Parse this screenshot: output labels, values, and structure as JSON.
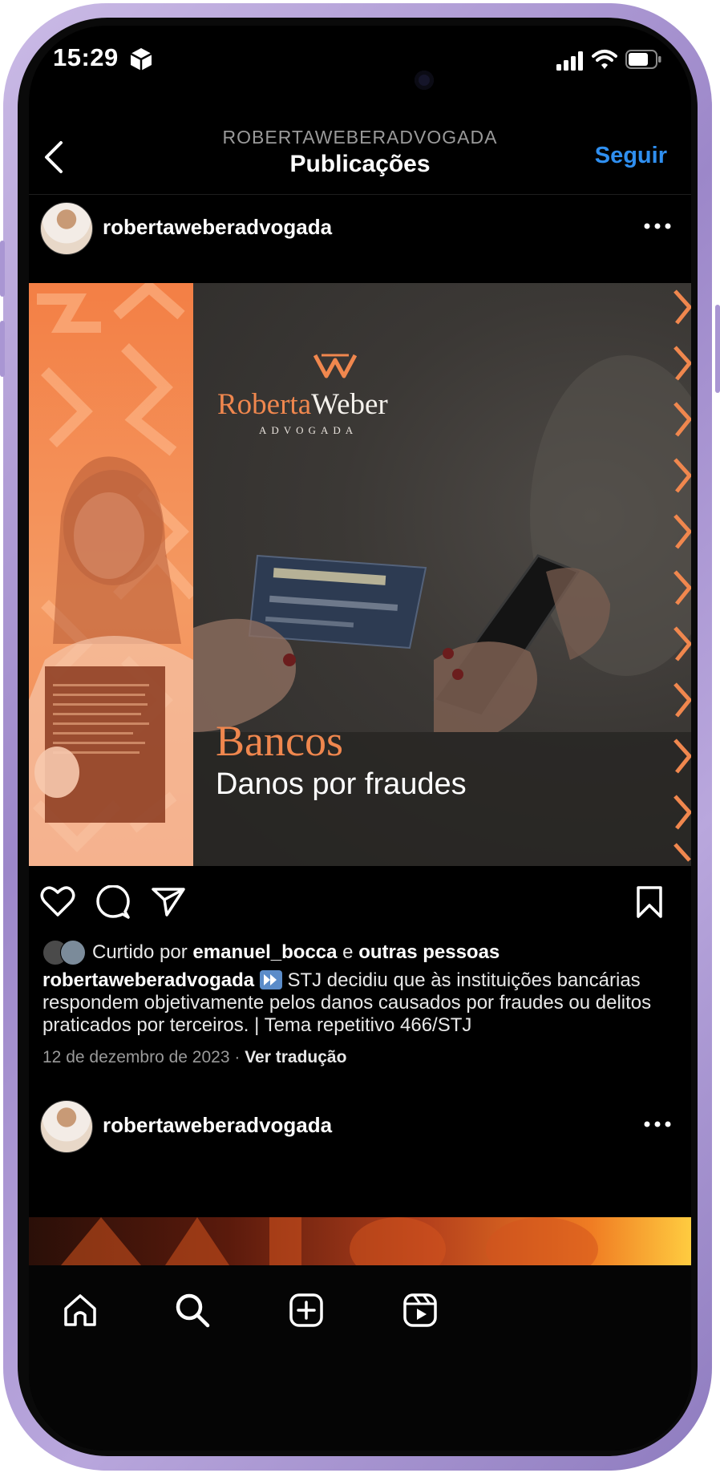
{
  "status_bar": {
    "time": "15:29"
  },
  "header": {
    "account": "ROBERTAWEBERADVOGADA",
    "title": "Publicações",
    "follow_label": "Seguir"
  },
  "post": {
    "username": "robertaweberadvogada",
    "image": {
      "brand_first": "Roberta",
      "brand_second": "Weber",
      "brand_sub": "ADVOGADA",
      "heading": "Bancos",
      "subheading": "Danos por fraudes"
    },
    "likes": {
      "prefix": "Curtido por",
      "user": "emanuel_bocca",
      "connector": "e",
      "others": "outras pessoas"
    },
    "caption": {
      "author": "robertaweberadvogada",
      "text": "STJ decidiu que às instituições bancárias respondem objetivamente pelos danos causados por fraudes ou delitos praticados por terceiros. | Tema repetitivo 466/STJ"
    },
    "date": "12 de dezembro de 2023",
    "separator": "·",
    "translate_label": "Ver tradução"
  },
  "post2": {
    "username": "robertaweberadvogada"
  },
  "tab_bar": {
    "items": [
      "home-icon",
      "search-icon",
      "create-post-icon",
      "reels-icon"
    ]
  },
  "colors": {
    "accent": "#2f8ff0",
    "brand_orange": "#f0874e",
    "background": "#000000"
  }
}
